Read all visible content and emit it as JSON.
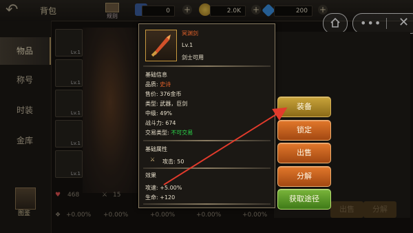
{
  "header": {
    "title": "背包",
    "guide_label": "规则",
    "currencies": [
      "0",
      "2.0K",
      "200"
    ]
  },
  "sidebar": {
    "tabs": [
      "物品",
      "称号",
      "时装",
      "金库"
    ],
    "bottom_label": "图鉴"
  },
  "slots": [
    {
      "level": "Lv.1"
    },
    {
      "level": "Lv.1"
    },
    {
      "level": "Lv.1"
    },
    {
      "level": "Lv.1"
    },
    {
      "level": "Lv.1"
    }
  ],
  "tooltip": {
    "item_name": "冥渊剑",
    "level": "Lv.1",
    "class_req": "剑士可用",
    "basic_header": "基础信息",
    "quality_label": "品质:",
    "quality_value": "史诗",
    "price": "售价: 376金币",
    "type": "类型: 武器，巨剑",
    "tier": "中级: 49%",
    "power": "战斗力: 674",
    "trade_label": "交易类型:",
    "trade_value": "不可交易",
    "attr_header": "基础属性",
    "attack": "攻击: 50",
    "effect_header": "效果",
    "effect1": "攻速: +5.00%",
    "effect2": "生命: +120"
  },
  "actions": [
    "装备",
    "锁定",
    "出售",
    "分解",
    "获取途径"
  ],
  "bottom_stats": {
    "hp": "468",
    "atk": "15",
    "pct": [
      "+0.00%",
      "+0.00%",
      "+0.00%",
      "+0.00%",
      "+0.00%"
    ]
  },
  "ghost_buttons": [
    "出售",
    "分解"
  ],
  "colors": {
    "arrow": "#e33b2c",
    "epic": "#e0612a",
    "untradable": "#2bd84a",
    "accent": "#c9a43a"
  }
}
